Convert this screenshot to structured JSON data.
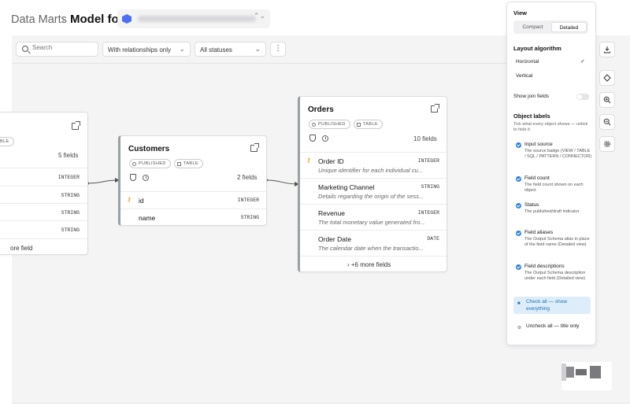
{
  "header": {
    "breadcrumb": "Data Marts",
    "separator": "›",
    "title": "Model for",
    "datasource_chevron": "⌃⌄"
  },
  "toolbar": {
    "search_placeholder": "Search",
    "relationships_filter": "With relationships only",
    "status_filter": "All statuses",
    "more_label": "⋮"
  },
  "right_tools": [
    "download-icon",
    "fit-view-icon",
    "zoom-in-icon",
    "zoom-out-icon",
    "settings-icon"
  ],
  "cards": {
    "left": {
      "badge": "BLE",
      "field_count": "5 fields",
      "types": [
        "INTEGER",
        "STRING",
        "STRING",
        "STRING"
      ],
      "more": "ore field"
    },
    "customers": {
      "title": "Customers",
      "status": "PUBLISHED",
      "type": "TABLE",
      "field_count": "2 fields",
      "fields": [
        {
          "name": "id",
          "type": "INTEGER"
        },
        {
          "name": "name",
          "type": "STRING"
        }
      ]
    },
    "orders": {
      "title": "Orders",
      "status": "PUBLISHED",
      "type": "TABLE",
      "field_count": "10 fields",
      "fields": [
        {
          "name": "Order ID",
          "type": "INTEGER",
          "desc": "Unique identifier for each individual cu..."
        },
        {
          "name": "Marketing Channel",
          "type": "STRING",
          "desc": "Details regarding the origin of the sess..."
        },
        {
          "name": "Revenue",
          "type": "INTEGER",
          "desc": "The total monetary value generated fro..."
        },
        {
          "name": "Order Date",
          "type": "DATE",
          "desc": "The calendar date when the transactio..."
        }
      ],
      "more": "› +6 more fields"
    }
  },
  "panel": {
    "view_title": "View",
    "view_compact": "Compact",
    "view_detailed": "Detailed",
    "layout_title": "Layout algorithm",
    "layout_horizontal": "Horizontal",
    "layout_vertical": "Vertical",
    "check_mark": "✓",
    "join_fields": "Show join fields",
    "labels_title": "Object labels",
    "labels_help": "Tick what every object shows — untick to hide it.",
    "options": [
      {
        "title": "Input source",
        "desc": "The source badge (VIEW / TABLE / SQL / PATTERN / CONNECTOR)"
      },
      {
        "title": "Field count",
        "desc": "The field count shown on each object"
      },
      {
        "title": "Status",
        "desc": "The published/draft indicator"
      },
      {
        "title": "Field aliases",
        "desc": "The Output Schema alias in place of the field name (Detailed view)"
      },
      {
        "title": "Field descriptions",
        "desc": "The Output Schema description under each field (Detailed view)"
      }
    ],
    "check_all": "Check all — show everything",
    "uncheck_all": "Uncheck all — title only"
  },
  "colors": {
    "accent": "#2b7fd8",
    "highlight_bg": "#ddeefa",
    "canvas_bg": "#f4f4f5",
    "key_icon": "#d4a11e"
  }
}
